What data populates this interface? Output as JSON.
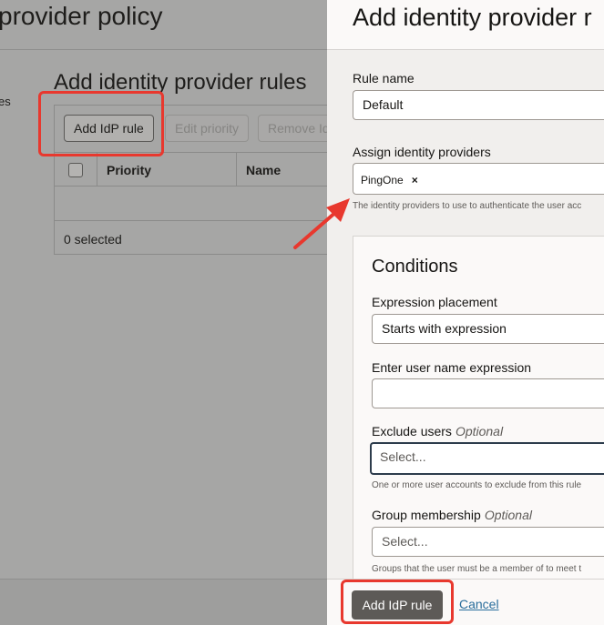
{
  "background": {
    "page_title": "provider policy",
    "side_fragment": "es",
    "section_title": "Add identity provider rules",
    "toolbar": {
      "add_label": "Add IdP rule",
      "edit_priority_label": "Edit priority",
      "remove_label": "Remove Id"
    },
    "table": {
      "columns": [
        "Priority",
        "Name"
      ],
      "rows": [],
      "selected_text": "0 selected"
    }
  },
  "drawer": {
    "title": "Add identity provider r",
    "rule_name": {
      "label": "Rule name",
      "value": "Default"
    },
    "assign_idps": {
      "label": "Assign identity providers",
      "chips": [
        "PingOne"
      ],
      "remove_glyph": "×",
      "help": "The identity providers to use to authenticate the user acc"
    },
    "conditions": {
      "title": "Conditions",
      "expression_placement": {
        "label": "Expression placement",
        "value": "Starts with expression"
      },
      "user_name_expression": {
        "label": "Enter user name expression",
        "value": ""
      },
      "exclude_users": {
        "label": "Exclude users",
        "optional": "Optional",
        "placeholder": "Select...",
        "help": "One or more user accounts to exclude from this rule"
      },
      "group_membership": {
        "label": "Group membership",
        "optional": "Optional",
        "placeholder": "Select...",
        "help": "Groups that the user must be a member of to meet t"
      }
    },
    "footer": {
      "primary_label": "Add IdP rule",
      "cancel_label": "Cancel"
    }
  },
  "colors": {
    "annotation": "#e8382e",
    "primary_button": "#5d5a57",
    "link": "#2a6e9c",
    "overlay": "#a6a6a5"
  },
  "icons": [
    "chip-remove-icon",
    "checkbox-icon",
    "annotation-arrow-icon"
  ]
}
